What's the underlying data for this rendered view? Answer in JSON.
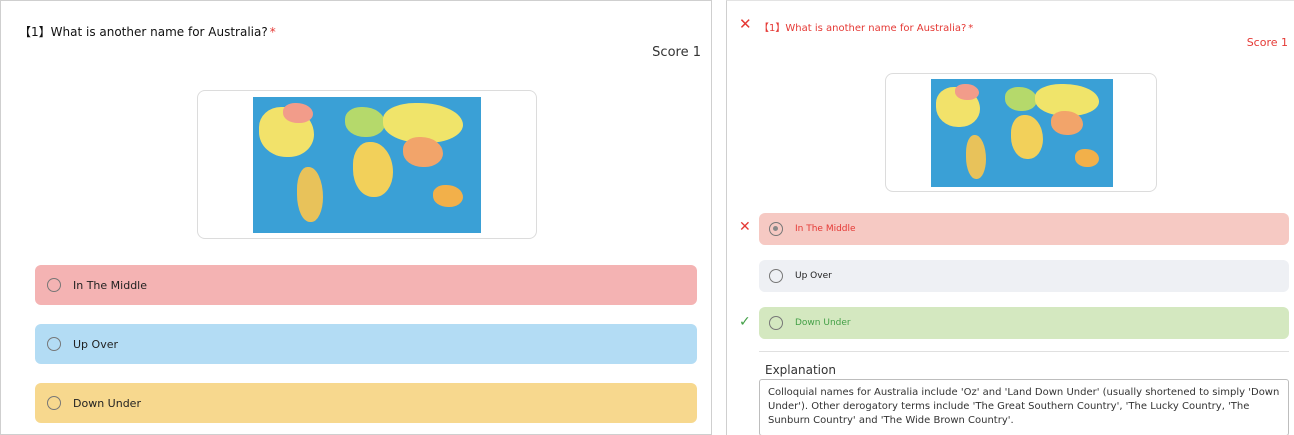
{
  "left": {
    "question": {
      "number": "【1】",
      "text": "What is another name for Australia?",
      "required_mark": "*"
    },
    "score_label": "Score 1",
    "options": [
      {
        "label": "In The Middle",
        "color": "#f4b3b3"
      },
      {
        "label": "Up Over",
        "color": "#b3dcf4"
      },
      {
        "label": "Down Under",
        "color": "#f7d88e"
      }
    ]
  },
  "right": {
    "result_icon": "cross-icon",
    "question": {
      "number": "【1】",
      "text": "What is another name for Australia?",
      "required_mark": "*"
    },
    "score_label": "Score 1",
    "options": [
      {
        "label": "In The Middle",
        "color": "#f6c9c3",
        "state": "selected-wrong",
        "mark_icon": "cross-icon"
      },
      {
        "label": "Up Over",
        "color": "#eef0f4",
        "state": "neutral"
      },
      {
        "label": "Down Under",
        "color": "#d4e8c0",
        "state": "correct",
        "mark_icon": "check-icon"
      }
    ],
    "explanation_title": "Explanation",
    "explanation_text": "Colloquial names for Australia include 'Oz' and 'Land Down Under' (usually shortened to simply 'Down Under'). Other derogatory terms include 'The Great Southern Country', 'The Lucky Country, 'The Sunburn Country' and 'The Wide Brown Country'."
  },
  "colors": {
    "wrong": "#e53935",
    "correct": "#43a047",
    "ocean": "#3aa0d6"
  }
}
